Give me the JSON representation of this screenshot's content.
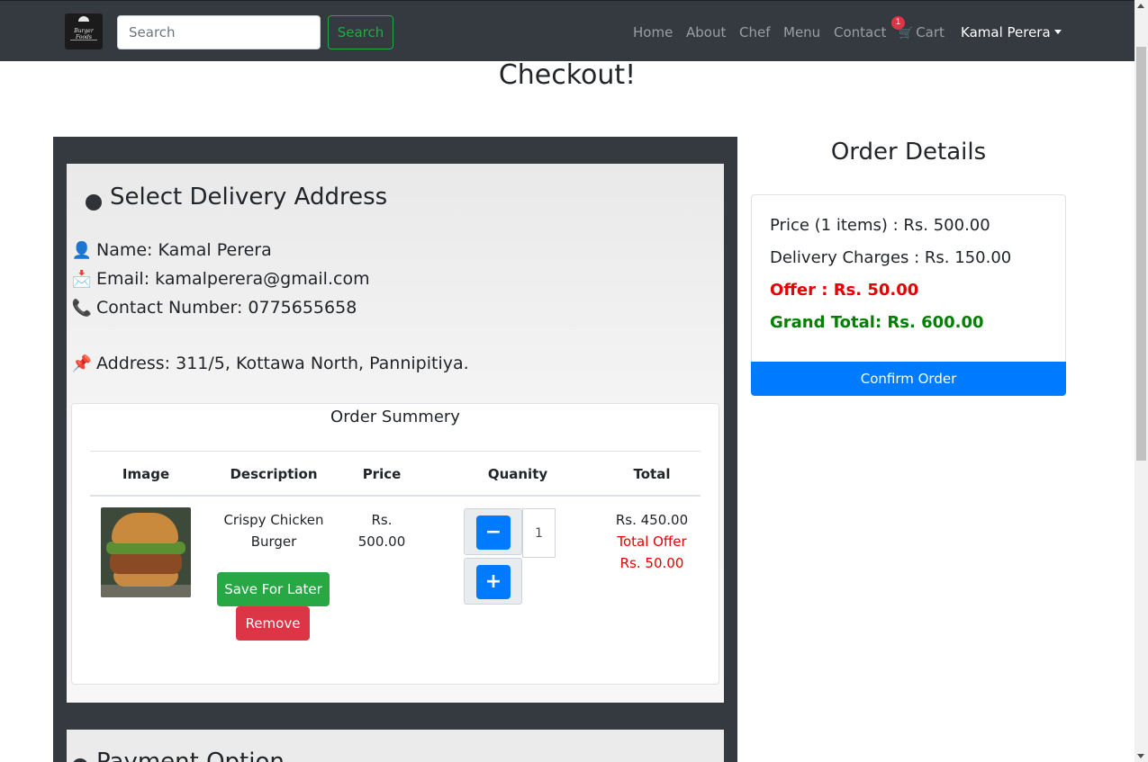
{
  "navbar": {
    "logo_text": "Burger Foods",
    "search_placeholder": "Search",
    "search_button": "Search",
    "links": [
      "Home",
      "About",
      "Chef",
      "Menu",
      "Contact"
    ],
    "cart_label": "Cart",
    "cart_count": "1",
    "user_name": "Kamal Perera"
  },
  "page": {
    "title": "Checkout!"
  },
  "address": {
    "heading": "Select Delivery Address",
    "name": "Name: Kamal Perera",
    "email": "Email: kamalperera@gmail.com",
    "contact": "Contact Number: 0775655658",
    "address": "Address: 311/5, Kottawa North, Pannipitiya."
  },
  "summary": {
    "title": "Order Summery",
    "headers": [
      "Image",
      "Description",
      "Price",
      "Quanity",
      "Total"
    ],
    "item": {
      "description_line1": "Crispy Chicken",
      "description_line2": "Burger",
      "price_line1": "Rs.",
      "price_line2": "500.00",
      "quantity": "1",
      "total": "Rs. 450.00",
      "offer_line1": "Total Offer",
      "offer_line2": "Rs. 50.00",
      "save_label": "Save For Later",
      "remove_label": "Remove",
      "minus_symbol": "−",
      "plus_symbol": "+"
    }
  },
  "payment": {
    "heading": "Payment Option"
  },
  "order_details": {
    "title": "Order Details",
    "price": "Price (1 items) : Rs. 500.00",
    "delivery": "Delivery Charges : Rs. 150.00",
    "offer": "Offer : Rs. 50.00",
    "grand_total": "Grand Total: Rs. 600.00",
    "confirm_label": "Confirm Order"
  },
  "colors": {
    "navbar": "#343a40",
    "success": "#28a745",
    "danger": "#dc3545",
    "primary": "#007bff",
    "offer_red": "#e60000",
    "total_green": "#008000"
  },
  "icons": {
    "name": "person-icon",
    "email": "envelope-icon",
    "contact": "phone-icon",
    "address": "pushpin-icon",
    "cart": "cart-icon"
  }
}
